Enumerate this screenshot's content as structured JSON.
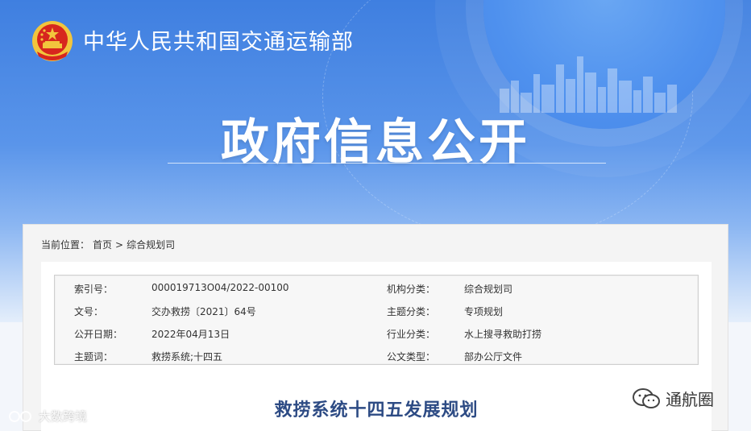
{
  "header": {
    "ministry_name": "中华人民共和国交通运输部",
    "section_title": "政府信息公开"
  },
  "breadcrumb": {
    "prefix": "当前位置：",
    "home": "首页",
    "separator": ">",
    "current": "综合规划司"
  },
  "meta": {
    "rows": [
      {
        "k1": "索引号：",
        "v1": "000019713O04/2022-00100",
        "k2": "机构分类：",
        "v2": "综合规划司"
      },
      {
        "k1": "文号：",
        "v1": "交办救捞〔2021〕64号",
        "k2": "主题分类：",
        "v2": "专项规划"
      },
      {
        "k1": "公开日期：",
        "v1": "2022年04月13日",
        "k2": "行业分类：",
        "v2": "水上搜寻救助打捞"
      },
      {
        "k1": "主题词：",
        "v1": "救捞系统;十四五",
        "k2": "公文类型：",
        "v2": "部办公厅文件"
      }
    ]
  },
  "document": {
    "title": "救捞系统十四五发展规划"
  },
  "watermarks": {
    "left": "大数跨境",
    "right": "通航圈"
  },
  "colors": {
    "banner_blue": "#3f7fe0",
    "title_blue": "#2d4b84",
    "emblem_red": "#d7261e",
    "emblem_gold": "#f2c53d"
  }
}
